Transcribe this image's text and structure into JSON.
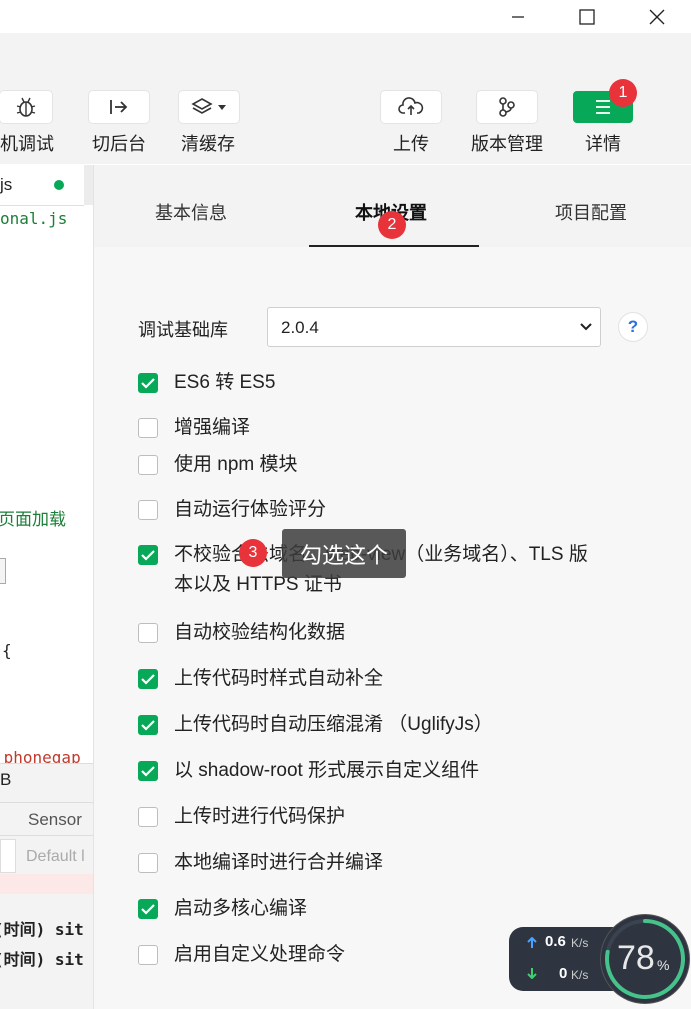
{
  "toolbar": {
    "debug_label": "真机调试",
    "background_label": "切后台",
    "cache_label": "清缓存",
    "upload_label": "上传",
    "version_label": "版本管理",
    "details_label": "详情"
  },
  "badges": {
    "b1": "1",
    "b2": "2",
    "b3": "3"
  },
  "editor": {
    "file_tab": "js",
    "lines": [
      "onal.js",
      "页面加载",
      "{",
      ".phonegap",
      "B",
      "Sensor",
      "Default l",
      "(时间) sit",
      "(时间) sit"
    ]
  },
  "tabs": {
    "basic": "基本信息",
    "local": "本地设置",
    "project": "项目配置"
  },
  "debug_lib": {
    "label": "调试基础库",
    "value": "2.0.4",
    "help": "?"
  },
  "tooltip": "勾选这个",
  "options": [
    {
      "label": "ES6 转 ES5",
      "checked": true
    },
    {
      "label": "增强编译",
      "checked": false
    },
    {
      "label": "使用 npm 模块",
      "checked": false
    },
    {
      "label": "自动运行体验评分",
      "checked": false
    },
    {
      "label": "不校验合法域名、web-view（业务域名）、TLS 版",
      "label2": "本以及 HTTPS 证书",
      "checked": true
    },
    {
      "label": "自动校验结构化数据",
      "checked": false
    },
    {
      "label": "上传代码时样式自动补全",
      "checked": true
    },
    {
      "label": "上传代码时自动压缩混淆 （UglifyJs）",
      "checked": true
    },
    {
      "label": "以 shadow-root 形式展示自定义组件",
      "checked": true
    },
    {
      "label": "上传时进行代码保护",
      "checked": false
    },
    {
      "label": "本地编译时进行合并编译",
      "checked": false
    },
    {
      "label": "启动多核心编译",
      "checked": true
    },
    {
      "label": "启用自定义处理命令",
      "checked": false
    }
  ],
  "net_widget": {
    "up": "0.6",
    "down": "0",
    "unit": "K/s",
    "percent": "78",
    "percent_sign": "%"
  },
  "colors": {
    "accent": "#07a858",
    "badge": "#e8333a"
  }
}
